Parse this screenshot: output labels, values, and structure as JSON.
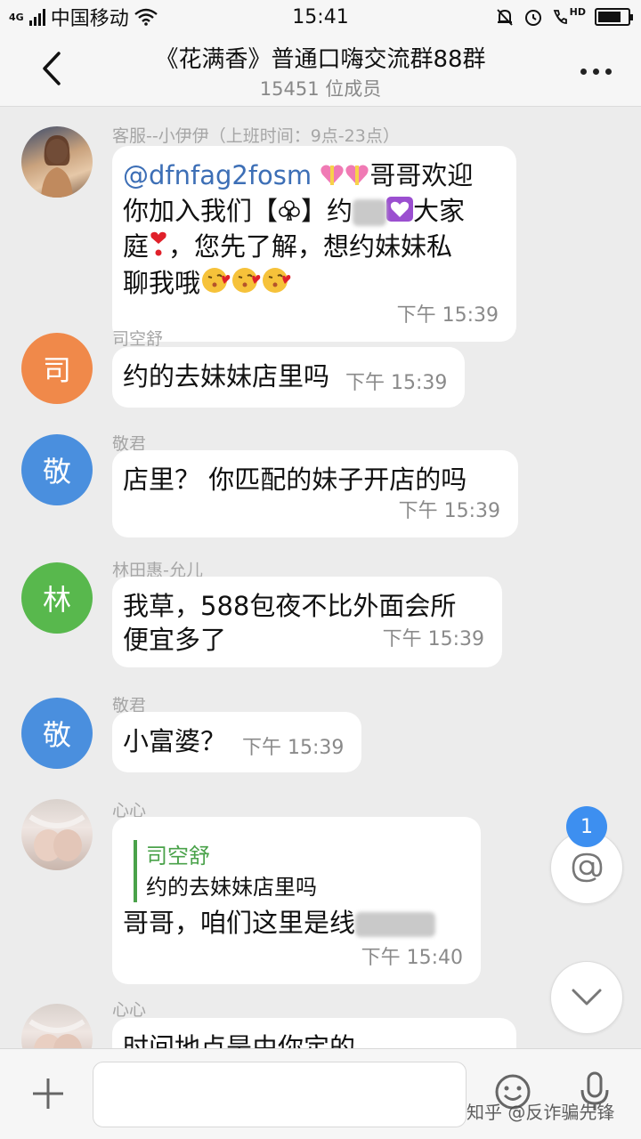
{
  "status_bar": {
    "network": "4G",
    "carrier": "中国移动",
    "time": "15:41",
    "hd": "HD"
  },
  "header": {
    "title": "《花满香》普通口嗨交流群88群",
    "subtitle": "15451 位成员",
    "back_icon": "chevron-left-icon",
    "more_icon": "more-dots-icon"
  },
  "messages": [
    {
      "sender": "客服--小伊伊（上班时间：9点-23点）",
      "avatar_kind": "photo",
      "lines": [
        "@dfnfag2fosm",
        "哥哥欢迎",
        "你加入我们【",
        "】约",
        "大家",
        "庭",
        "，您先了解，想约妹妹私",
        "聊我哦"
      ],
      "time": "下午 15:39"
    },
    {
      "sender": "司空舒",
      "avatar_char": "司",
      "avatar_color": "#f0894a",
      "text": "约的去妹妹店里吗",
      "time": "下午 15:39"
    },
    {
      "sender": "敬君",
      "avatar_char": "敬",
      "avatar_color": "#4a8fde",
      "text": "店里？ 你匹配的妹子开店的吗",
      "time": "下午 15:39"
    },
    {
      "sender": "林田惠-允儿",
      "avatar_char": "林",
      "avatar_color": "#58b84d",
      "lines": [
        "我草，588包夜不比外面会所",
        "便宜多了"
      ],
      "time": "下午 15:39"
    },
    {
      "sender": "敬君",
      "avatar_char": "敬",
      "avatar_color": "#4a8fde",
      "text": "小富婆？",
      "time": "下午 15:39"
    },
    {
      "sender": "心心",
      "avatar_kind": "photo",
      "quote_name": "司空舒",
      "quote_text": "约的去妹妹店里吗",
      "text": "哥哥，咱们这里是线",
      "time": "下午 15:40"
    },
    {
      "sender": "心心",
      "avatar_kind": "photo",
      "text": "时间地点是由你定的"
    }
  ],
  "floating": {
    "mention_count": "1",
    "mention_icon": "at-sign-icon",
    "scroll_icon": "chevron-down-icon"
  },
  "input_bar": {
    "plus_icon": "plus-icon",
    "emoji_icon": "smiley-icon",
    "voice_icon": "microphone-icon",
    "placeholder": ""
  },
  "watermark": "知乎 @反诈骗先锋"
}
